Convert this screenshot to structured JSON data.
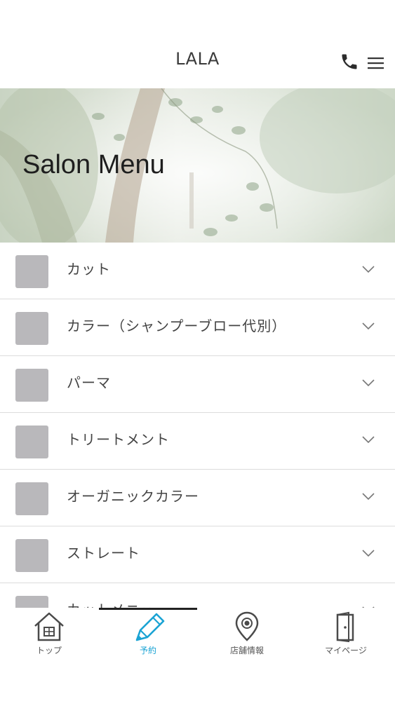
{
  "header": {
    "title": "LALA",
    "phone_icon": "phone-icon",
    "menu_icon": "hamburger-menu-icon"
  },
  "hero": {
    "title": "Salon Menu"
  },
  "menu": {
    "items": [
      {
        "label": "カット"
      },
      {
        "label": "カラー（シャンプーブロー代別）"
      },
      {
        "label": "パーマ"
      },
      {
        "label": "トリートメント"
      },
      {
        "label": "オーガニックカラー"
      },
      {
        "label": "ストレート"
      },
      {
        "label": "カットメニュー"
      }
    ]
  },
  "bottom_nav": {
    "items": [
      {
        "label": "トップ",
        "icon": "home-icon"
      },
      {
        "label": "予約",
        "icon": "pencil-icon"
      },
      {
        "label": "店舗情報",
        "icon": "location-pin-icon"
      },
      {
        "label": "マイページ",
        "icon": "door-icon"
      }
    ],
    "active_index": 1
  },
  "colors": {
    "accent": "#1aa3d4",
    "thumb": "#b9b8bb",
    "divider": "#dcdcdc"
  }
}
